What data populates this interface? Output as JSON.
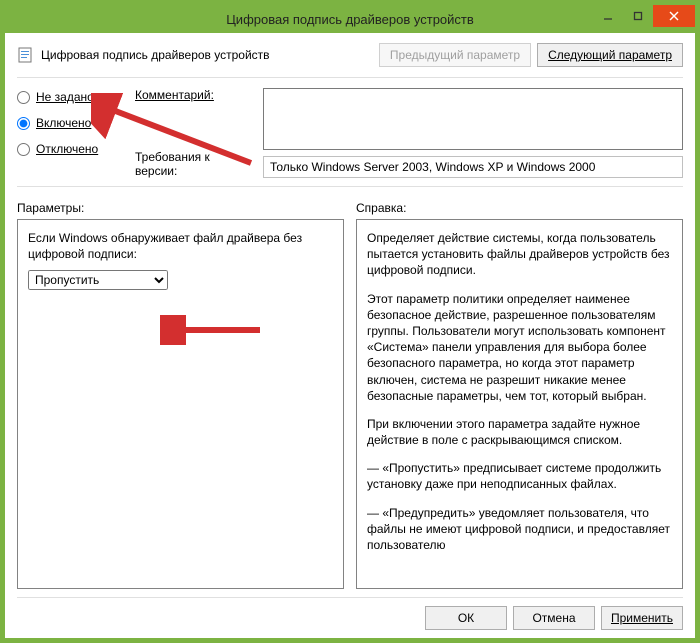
{
  "window": {
    "title": "Цифровая подпись драйверов устройств"
  },
  "header": {
    "title": "Цифровая подпись драйверов устройств",
    "prev": "Предыдущий параметр",
    "next": "Следующий параметр"
  },
  "radios": {
    "not_configured": "Не задано",
    "enabled": "Включено",
    "disabled": "Отключено"
  },
  "labels": {
    "comment": "Комментарий:",
    "requirements": "Требования к версии:",
    "params": "Параметры:",
    "help": "Справка:"
  },
  "requirements_value": "Только Windows Server 2003, Windows XP и Windows 2000",
  "params": {
    "prompt": "Если Windows обнаруживает файл драйвера без цифровой подписи:",
    "selected": "Пропустить"
  },
  "help": {
    "p1": "Определяет действие системы, когда пользователь пытается установить файлы драйверов устройств без цифровой подписи.",
    "p2": "Этот параметр политики определяет наименее безопасное действие, разрешенное пользователям группы. Пользователи могут использовать компонент «Система» панели управления для выбора более безопасного параметра, но когда этот параметр включен, система не разрешит никакие менее безопасные параметры, чем тот, который выбран.",
    "p3": "При включении этого параметра задайте нужное действие в поле с раскрывающимся списком.",
    "p4": "— «Пропустить» предписывает системе продолжить установку даже при неподписанных файлах.",
    "p5": "— «Предупредить» уведомляет пользователя, что файлы не имеют цифровой подписи, и предоставляет пользователю"
  },
  "footer": {
    "ok": "ОК",
    "cancel": "Отмена",
    "apply": "Применить"
  }
}
